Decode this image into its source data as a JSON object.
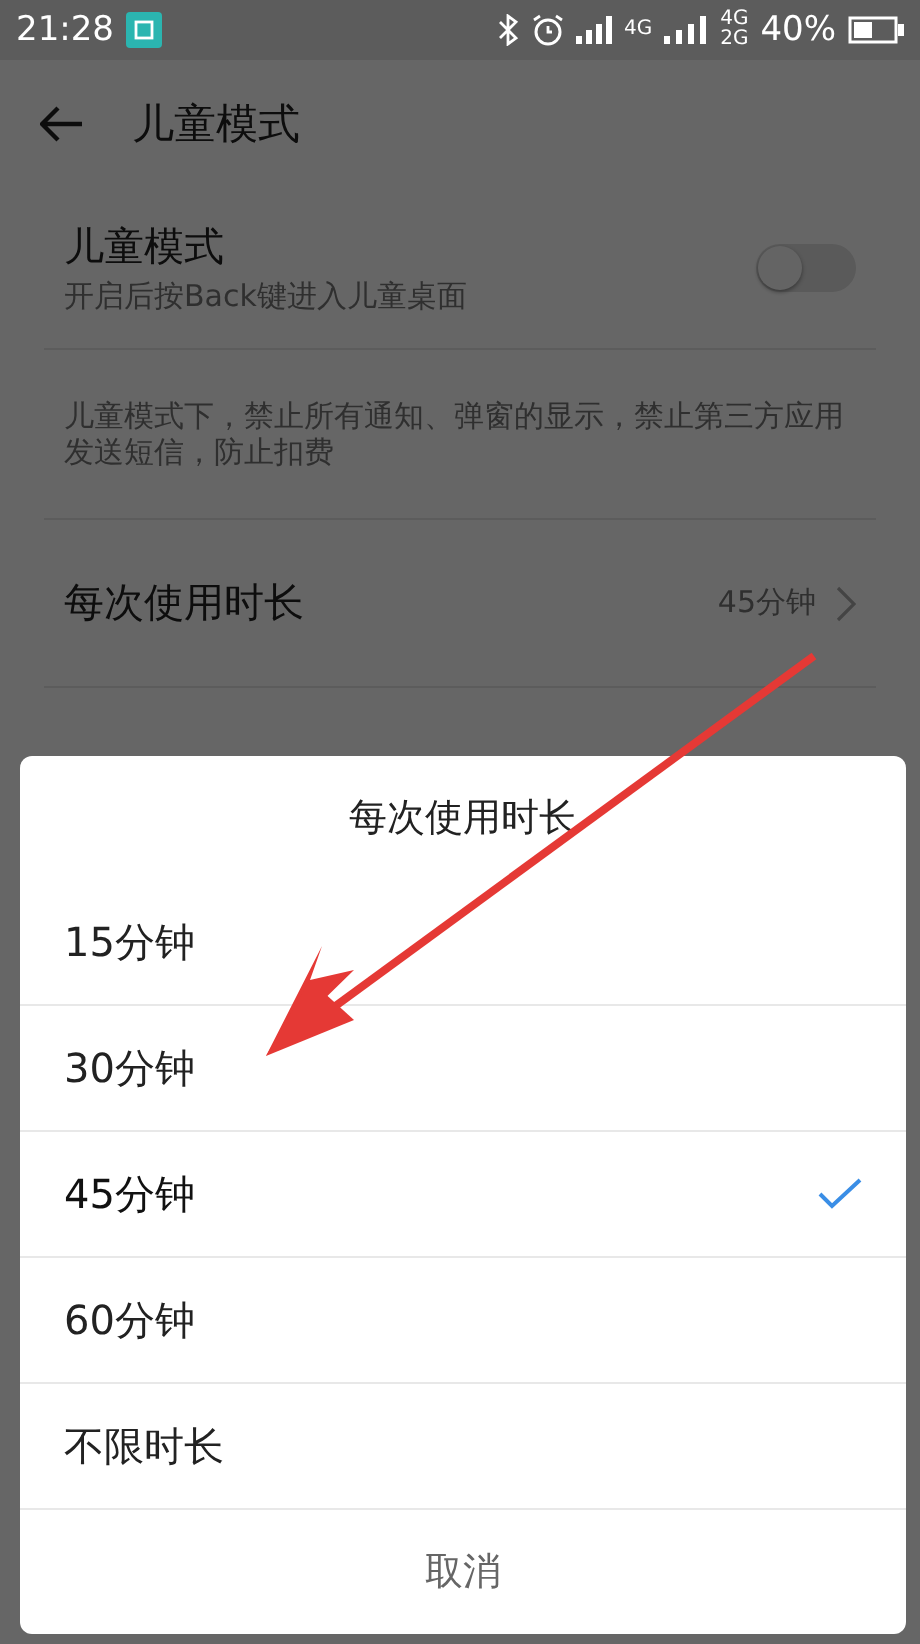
{
  "status_bar": {
    "time": "21:28",
    "network_labels": [
      "4G",
      "4G",
      "2G"
    ],
    "battery": "40%"
  },
  "toolbar": {
    "title": "儿童模式"
  },
  "settings": [
    {
      "kind": "toggle",
      "title": "儿童模式",
      "subtitle": "开启后按Back键进入儿童桌面",
      "on": false
    },
    {
      "kind": "note",
      "text": "儿童模式下，禁止所有通知、弹窗的显示，禁止第三方应用发送短信，防止扣费"
    },
    {
      "kind": "link",
      "title": "每次使用时长",
      "value": "45分钟"
    }
  ],
  "dialog": {
    "title": "每次使用时长",
    "options": [
      {
        "label": "15分钟",
        "selected": false
      },
      {
        "label": "30分钟",
        "selected": false
      },
      {
        "label": "45分钟",
        "selected": true
      },
      {
        "label": "60分钟",
        "selected": false
      },
      {
        "label": "不限时长",
        "selected": false
      }
    ],
    "cancel": "取消"
  }
}
